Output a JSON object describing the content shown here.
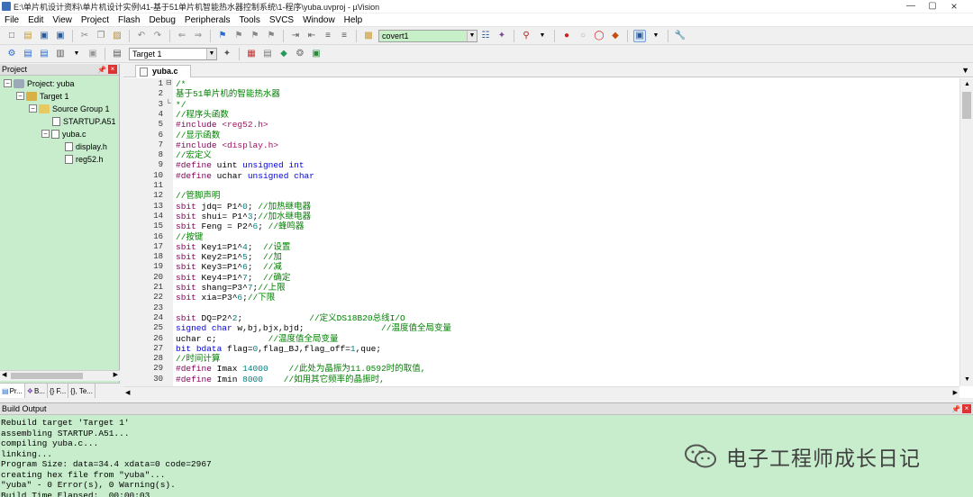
{
  "window": {
    "title": "E:\\单片机设计资料\\单片机设计实例\\41-基于51单片机智能热水器控制系统\\1-程序\\yuba.uvproj - µVision"
  },
  "menu": [
    "File",
    "Edit",
    "View",
    "Project",
    "Flash",
    "Debug",
    "Peripherals",
    "Tools",
    "SVCS",
    "Window",
    "Help"
  ],
  "toolbar": {
    "find_value": "covert1",
    "target_value": "Target 1"
  },
  "project": {
    "title": "Project",
    "root": "Project: yuba",
    "target": "Target 1",
    "group": "Source Group 1",
    "files": [
      "STARTUP.A51",
      "yuba.c",
      "display.h",
      "reg52.h"
    ],
    "tabs": [
      "Pr...",
      "B...",
      "{} F...",
      "{}, Te..."
    ]
  },
  "editor": {
    "tab": "yuba.c",
    "lines": [
      {
        "n": "1",
        "html": "<span class=\"cm\">/*</span>"
      },
      {
        "n": "2",
        "html": "<span class=\"cm\">基于51单片机的智能热水器</span>"
      },
      {
        "n": "3",
        "html": "<span class=\"cm\">*/</span>"
      },
      {
        "n": "4",
        "html": "<span class=\"cm\">//程序头函数</span>"
      },
      {
        "n": "5",
        "html": "<span class=\"pp\">#include</span> <span class=\"st\">&lt;reg52.h&gt;</span>"
      },
      {
        "n": "6",
        "html": "<span class=\"cm\">//显示函数</span>"
      },
      {
        "n": "7",
        "html": "<span class=\"pp\">#include</span> <span class=\"st\">&lt;display.h&gt;</span>"
      },
      {
        "n": "8",
        "html": "<span class=\"cm\">//宏定义</span>"
      },
      {
        "n": "9",
        "html": "<span class=\"pp\">#define</span> uint <span class=\"kw\">unsigned int</span>"
      },
      {
        "n": "10",
        "html": "<span class=\"pp\">#define</span> uchar <span class=\"kw\">unsigned char</span>"
      },
      {
        "n": "11",
        "html": ""
      },
      {
        "n": "12",
        "html": "<span class=\"cm\">//管脚声明</span>"
      },
      {
        "n": "13",
        "html": "<span class=\"pp\">sbit</span> jdq= P1^<span class=\"nm\">0</span>; <span class=\"cm\">//加热继电器</span>"
      },
      {
        "n": "14",
        "html": "<span class=\"pp\">sbit</span> shui= P1^<span class=\"nm\">3</span>;<span class=\"cm\">//加水继电器</span>"
      },
      {
        "n": "15",
        "html": "<span class=\"pp\">sbit</span> Feng = P2^<span class=\"nm\">6</span>; <span class=\"cm\">//蜂鸣器</span>"
      },
      {
        "n": "16",
        "html": "<span class=\"cm\">//按键</span>"
      },
      {
        "n": "17",
        "html": "<span class=\"pp\">sbit</span> Key1=P1^<span class=\"nm\">4</span>;  <span class=\"cm\">//设置</span>"
      },
      {
        "n": "18",
        "html": "<span class=\"pp\">sbit</span> Key2=P1^<span class=\"nm\">5</span>;  <span class=\"cm\">//加</span>"
      },
      {
        "n": "19",
        "html": "<span class=\"pp\">sbit</span> Key3=P1^<span class=\"nm\">6</span>;  <span class=\"cm\">//减</span>"
      },
      {
        "n": "20",
        "html": "<span class=\"pp\">sbit</span> Key4=P1^<span class=\"nm\">7</span>;  <span class=\"cm\">//确定</span>"
      },
      {
        "n": "21",
        "html": "<span class=\"pp\">sbit</span> shang=P3^<span class=\"nm\">7</span>;<span class=\"cm\">//上限</span>"
      },
      {
        "n": "22",
        "html": "<span class=\"pp\">sbit</span> xia=P3^<span class=\"nm\">6</span>;<span class=\"cm\">//下限</span>"
      },
      {
        "n": "23",
        "html": ""
      },
      {
        "n": "24",
        "html": "<span class=\"pp\">sbit</span> DQ=P2^<span class=\"nm\">2</span>;             <span class=\"cm\">//定义DS18B20总线I/O</span>"
      },
      {
        "n": "25",
        "html": "<span class=\"kw\">signed char</span> w,bj,bjx,bjd;               <span class=\"cm\">//温度值全局变量</span>"
      },
      {
        "n": "26",
        "html": "uchar c;          <span class=\"cm\">//温度值全局变量</span>"
      },
      {
        "n": "27",
        "html": "<span class=\"kw\">bit</span> <span class=\"kw\">bdata</span> flag=<span class=\"nm\">0</span>,flag_BJ,flag_off=<span class=\"nm\">1</span>,que;"
      },
      {
        "n": "28",
        "html": "<span class=\"cm\">//时间计算</span>"
      },
      {
        "n": "29",
        "html": "<span class=\"pp\">#define</span> Imax <span class=\"nm\">14000</span>    <span class=\"cm\">//此处为晶振为11.0592时的取值,</span>"
      },
      {
        "n": "30",
        "html": "<span class=\"pp\">#define</span> Imin <span class=\"nm\">8000</span>    <span class=\"cm\">//如用其它频率的晶振时,</span>"
      }
    ]
  },
  "build": {
    "title": "Build Output",
    "lines": [
      "Rebuild target 'Target 1'",
      "assembling STARTUP.A51...",
      "compiling yuba.c...",
      "linking...",
      "Program Size: data=34.4 xdata=0 code=2967",
      "creating hex file from \"yuba\"...",
      "\"yuba\" - 0 Error(s), 0 Warning(s).",
      "Build Time Elapsed:  00:00:03"
    ],
    "watermark": "电子工程师成长日记"
  }
}
